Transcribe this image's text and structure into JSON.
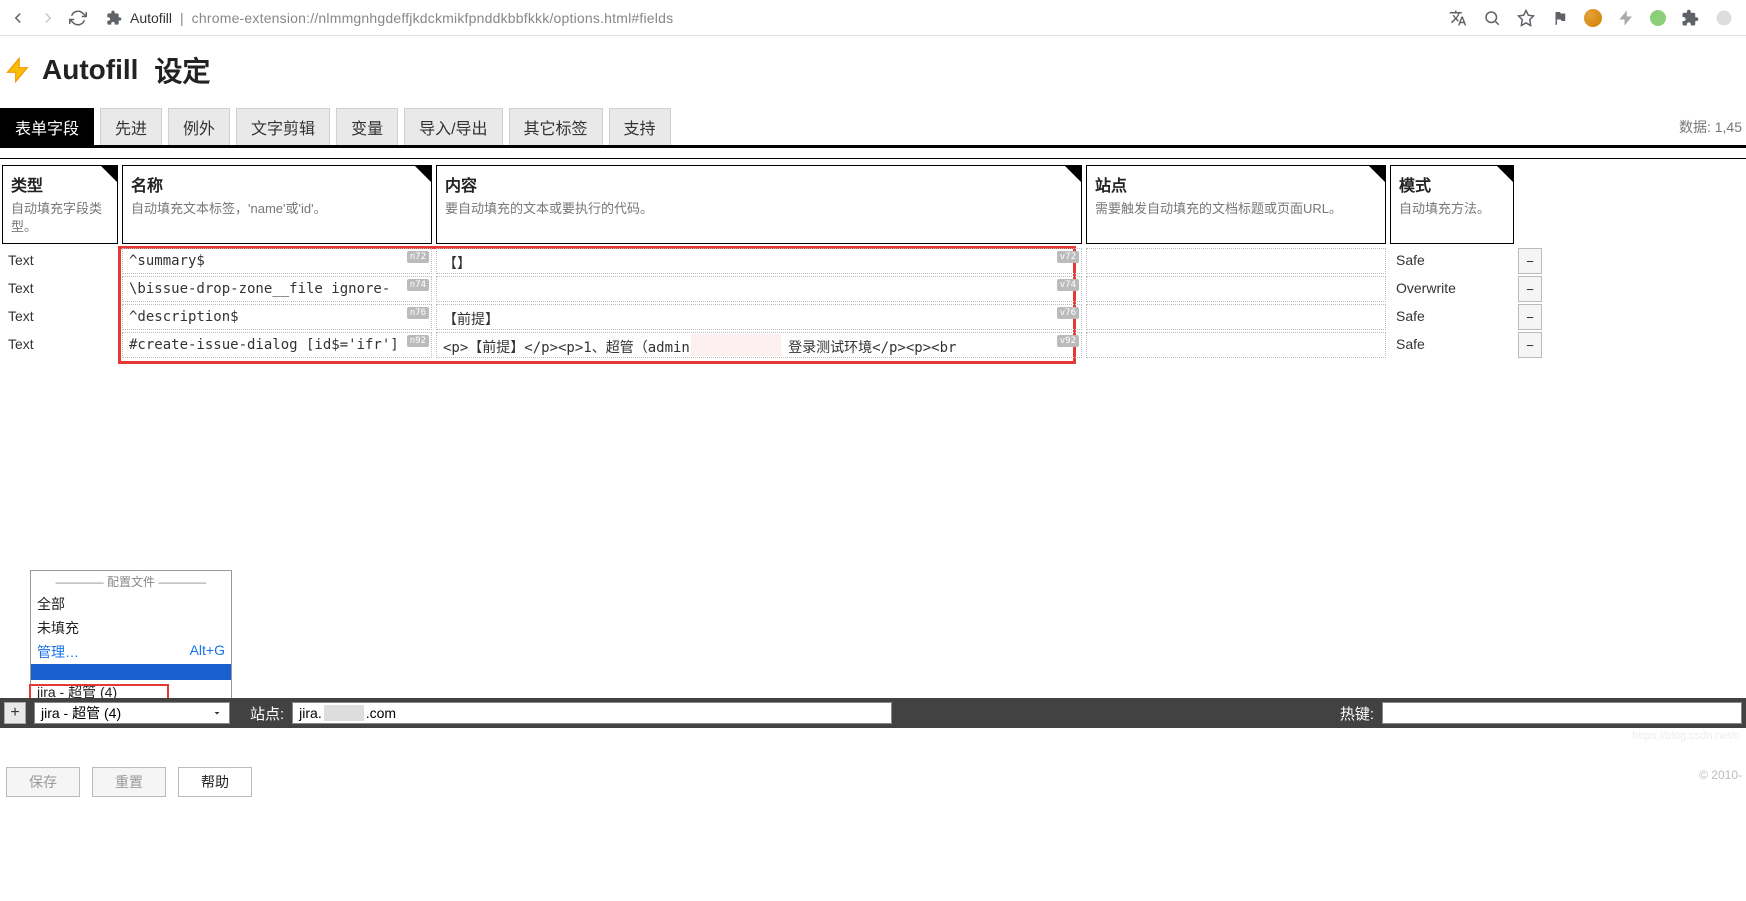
{
  "browser": {
    "label": "Autofill",
    "url": "chrome-extension://nlmmgnhgdeffjkdckmikfpnddkbbfkkk/options.html#fields"
  },
  "header": {
    "title": "Autofill",
    "subtitle": "设定"
  },
  "tabs": {
    "items": [
      "表单字段",
      "先进",
      "例外",
      "文字剪辑",
      "变量",
      "导入/导出",
      "其它标签",
      "支持"
    ],
    "active_index": 0,
    "data_label": "数据: 1,45"
  },
  "columns": {
    "type": {
      "title": "类型",
      "desc": "自动填充字段类型。"
    },
    "name": {
      "title": "名称",
      "desc": "自动填充文本标签，'name'或'id'。"
    },
    "content": {
      "title": "内容",
      "desc": "要自动填充的文本或要执行的代码。"
    },
    "site": {
      "title": "站点",
      "desc": "需要触发自动填充的文档标题或页面URL。"
    },
    "mode": {
      "title": "模式",
      "desc": "自动填充方法。"
    }
  },
  "rows": [
    {
      "type": "Text",
      "name": "^summary$",
      "name_badge": "n72",
      "content": "【】",
      "content_badge": "v72",
      "site": "",
      "mode": "Safe"
    },
    {
      "type": "Text",
      "name": "\\bissue-drop-zone__file ignore-",
      "name_badge": "n74",
      "content": "",
      "content_badge": "v74",
      "site": "",
      "mode": "Overwrite"
    },
    {
      "type": "Text",
      "name": "^description$",
      "name_badge": "n76",
      "content": "【前提】",
      "content_badge": "v76",
      "site": "",
      "mode": "Safe"
    },
    {
      "type": "Text",
      "name": "#create-issue-dialog  [id$='ifr']",
      "name_badge": "n92",
      "content": "<p>【前提】</p><p>1、超管（admin            /Ab123456）登录测试环境</p><p><br",
      "content_badge": "v92",
      "site": "",
      "mode": "Safe"
    }
  ],
  "profile_popup": {
    "header": "———— 配置文件 ————",
    "all": "全部",
    "unfilled": "未填充",
    "manage": "管理…",
    "shortcut": "Alt+G",
    "jira": "jira - 超管 (4)"
  },
  "status": {
    "profile_selected": "jira - 超管 (4)",
    "site_label": "站点:",
    "site_prefix": "jira.",
    "site_suffix": ".com",
    "hotkey_label": "热键:"
  },
  "buttons": {
    "save": "保存",
    "reset": "重置",
    "help": "帮助"
  },
  "footer": {
    "copyright": "© 2010-",
    "watermark": "https://blog.csdn.net/o"
  }
}
